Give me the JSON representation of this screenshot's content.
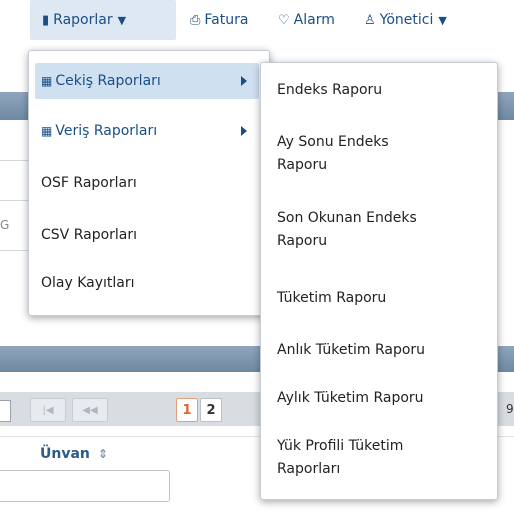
{
  "topbar": {
    "reports": {
      "label": "Raporlar",
      "icon": "report-icon"
    },
    "invoice": {
      "label": "Fatura",
      "icon": "printer-icon"
    },
    "alarm": {
      "label": "Alarm",
      "icon": "bulb-icon"
    },
    "admin": {
      "label": "Yönetici",
      "icon": "user-icon"
    }
  },
  "reports_menu": {
    "items": [
      {
        "label": "Cekiş Raporları",
        "has_submenu": true,
        "icon": "table-icon"
      },
      {
        "label": "Veriş Raporları",
        "has_submenu": true,
        "icon": "table-icon"
      },
      {
        "label": "OSF Raporları"
      },
      {
        "label": "CSV Raporları"
      },
      {
        "label": "Olay Kayıtları"
      }
    ]
  },
  "cekis_submenu": {
    "items": [
      {
        "label": "Endeks Raporu"
      },
      {
        "label": "Ay Sonu Endeks Raporu"
      },
      {
        "label": "Son Okunan Endeks Raporu"
      },
      {
        "label": "Tüketim Raporu"
      },
      {
        "label": "Anlık Tüketim Raporu"
      },
      {
        "label": "Aylık Tüketim Raporu"
      },
      {
        "label": "Yük Profili Tüketim Raporları"
      }
    ]
  },
  "background": {
    "pager": {
      "pages": [
        "1",
        "2"
      ],
      "current": "1",
      "partial_right": "9"
    },
    "column_header": "Ünvan",
    "left_partial": "G"
  },
  "colors": {
    "accent": "#1a4f86",
    "menu_active_bg": "#cfe0f1",
    "current_page": "#e0662b"
  }
}
